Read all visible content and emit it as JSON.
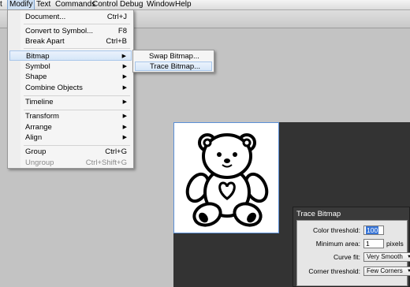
{
  "menubar": {
    "items": [
      {
        "label": "t"
      },
      {
        "label": "Modify"
      },
      {
        "label": "Text"
      },
      {
        "label": "Commands"
      },
      {
        "label": "Control"
      },
      {
        "label": "Debug"
      },
      {
        "label": "Window"
      },
      {
        "label": "Help"
      }
    ]
  },
  "modify_menu": {
    "document": {
      "label": "Document...",
      "shortcut": "Ctrl+J"
    },
    "convert": {
      "label": "Convert to Symbol...",
      "shortcut": "F8"
    },
    "break_apart": {
      "label": "Break Apart",
      "shortcut": "Ctrl+B"
    },
    "bitmap": {
      "label": "Bitmap"
    },
    "symbol": {
      "label": "Symbol"
    },
    "shape": {
      "label": "Shape"
    },
    "combine": {
      "label": "Combine Objects"
    },
    "timeline": {
      "label": "Timeline"
    },
    "transform": {
      "label": "Transform"
    },
    "arrange": {
      "label": "Arrange"
    },
    "align": {
      "label": "Align"
    },
    "group": {
      "label": "Group",
      "shortcut": "Ctrl+G"
    },
    "ungroup": {
      "label": "Ungroup",
      "shortcut": "Ctrl+Shift+G"
    },
    "submenu_arrow": "▶"
  },
  "bitmap_submenu": {
    "swap": "Swap Bitmap...",
    "trace": "Trace Bitmap..."
  },
  "trace_dialog": {
    "title": "Trace Bitmap",
    "color_threshold_label": "Color threshold:",
    "color_threshold_value": "100",
    "minimum_area_label": "Minimum area:",
    "minimum_area_value": "1",
    "minimum_area_unit": "pixels",
    "curve_fit_label": "Curve fit:",
    "curve_fit_value": "Very Smooth",
    "corner_threshold_label": "Corner threshold:",
    "corner_threshold_value": "Few Corners",
    "dropdown_caret": "▼"
  },
  "colors": {
    "highlight": "#d6e6f8",
    "stage_border": "#5b8fd6",
    "pasteboard": "#333333",
    "selection": "#3875d7"
  }
}
